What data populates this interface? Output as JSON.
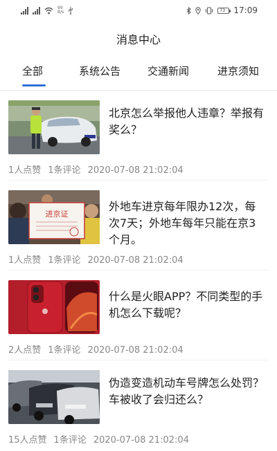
{
  "status_bar": {
    "speed_value": "99",
    "speed_unit": "B/s",
    "battery": "73",
    "time": "17:09"
  },
  "header": {
    "title": "消息中心"
  },
  "tabs": [
    {
      "label": "全部",
      "active": true
    },
    {
      "label": "系统公告",
      "active": false
    },
    {
      "label": "交通新闻",
      "active": false
    },
    {
      "label": "进京须知",
      "active": false
    }
  ],
  "accent_color": "#2f6fd6",
  "news": [
    {
      "title": "北京怎么举报他人违章？举报有奖么？",
      "likes": "1人点赞",
      "comments": "1条评论",
      "date": "2020-07-08 21:02:04",
      "thumb_icon": "traffic-police-photo"
    },
    {
      "title": "外地车进京每年限办12次，每次7天；外地车每年只能在京3个月。",
      "likes": "1人点赞",
      "comments": "1条评论",
      "date": "2020-07-08 21:02:04",
      "thumb_icon": "beijing-entry-permit-photo",
      "thumb_text": "进京证"
    },
    {
      "title": "什么是火眼APP？不同类型的手机怎么下载呢？",
      "likes": "2人点赞",
      "comments": "1条评论",
      "date": "2020-07-08 21:02:04",
      "thumb_icon": "iphone-photo"
    },
    {
      "title": "伪造变造机动车号牌怎么处罚？车被收了会归还么？",
      "likes": "15人点赞",
      "comments": "1条评论",
      "date": "2020-07-08 21:02:04",
      "thumb_icon": "parked-cars-photo"
    }
  ]
}
